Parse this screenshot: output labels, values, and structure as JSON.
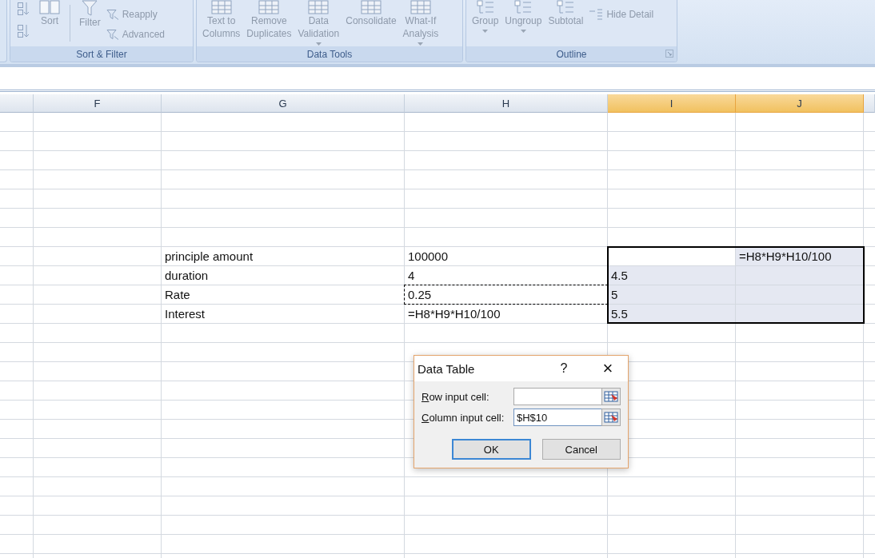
{
  "ribbon": {
    "groups": [
      {
        "label": "Sort & Filter",
        "buttons": [
          {
            "kind": "sorticons",
            "disabled": true
          },
          {
            "kind": "large",
            "label": "Sort",
            "disabled": true
          },
          {
            "kind": "divider"
          },
          {
            "kind": "large",
            "label": "Filter",
            "disabled": true
          },
          {
            "kind": "small",
            "label": "Reapply",
            "disabled": true
          },
          {
            "kind": "small",
            "label": "Advanced",
            "disabled": true
          }
        ]
      },
      {
        "label": "Data Tools",
        "buttons": [
          {
            "kind": "large",
            "label": "Text to Columns",
            "disabled": true
          },
          {
            "kind": "large",
            "label": "Remove Duplicates",
            "disabled": true
          },
          {
            "kind": "large",
            "label": "Data Validation",
            "dropdown": true,
            "disabled": true
          },
          {
            "kind": "large",
            "label": "Consolidate",
            "disabled": true
          },
          {
            "kind": "large",
            "label": "What-If Analysis",
            "dropdown": true,
            "disabled": true
          }
        ]
      },
      {
        "label": "Outline",
        "launcher": true,
        "buttons": [
          {
            "kind": "large",
            "label": "Group",
            "dropdown": true,
            "disabled": true
          },
          {
            "kind": "large",
            "label": "Ungroup",
            "dropdown": true,
            "disabled": true
          },
          {
            "kind": "large",
            "label": "Subtotal",
            "disabled": true
          },
          {
            "kind": "small",
            "label": "Hide Detail",
            "disabled": true
          }
        ]
      }
    ]
  },
  "sheet": {
    "columns": [
      {
        "label": "F",
        "selected": false
      },
      {
        "label": "G",
        "selected": false
      },
      {
        "label": "H",
        "selected": false
      },
      {
        "label": "I",
        "selected": true
      },
      {
        "label": "J",
        "selected": true
      }
    ],
    "rows": [
      {
        "cells": [
          {},
          {
            "text": "principle amount",
            "selected": false
          },
          {
            "text": "100000",
            "selected": false
          },
          {
            "selected": true,
            "active": true
          },
          {
            "text": "=H8*H9*H10/100",
            "selected": true
          }
        ]
      },
      {
        "cells": [
          {},
          {
            "text": "duration",
            "selected": false
          },
          {
            "text": "4",
            "selected": false
          },
          {
            "text": "4.5",
            "selected": true
          },
          {
            "selected": true
          }
        ]
      },
      {
        "cells": [
          {},
          {
            "text": "Rate",
            "selected": false
          },
          {
            "text": "0.25",
            "selected": false,
            "copy_marquee": true
          },
          {
            "text": "5",
            "selected": true
          },
          {
            "selected": true
          }
        ]
      },
      {
        "cells": [
          {},
          {
            "text": "Interest",
            "selected": false
          },
          {
            "text": "=H8*H9*H10/100",
            "selected": false
          },
          {
            "text": "5.5",
            "selected": true
          },
          {
            "selected": true
          }
        ]
      }
    ]
  },
  "dialog": {
    "title": "Data Table",
    "help": "?",
    "close": "×",
    "fields": [
      {
        "label": "Row input cell:",
        "focused": false
      },
      {
        "label": "Column input cell:",
        "value": "$H$10",
        "focused": true
      }
    ],
    "buttons": [
      {
        "label": "OK",
        "default": true
      },
      {
        "label": "Cancel",
        "default": false
      }
    ]
  }
}
